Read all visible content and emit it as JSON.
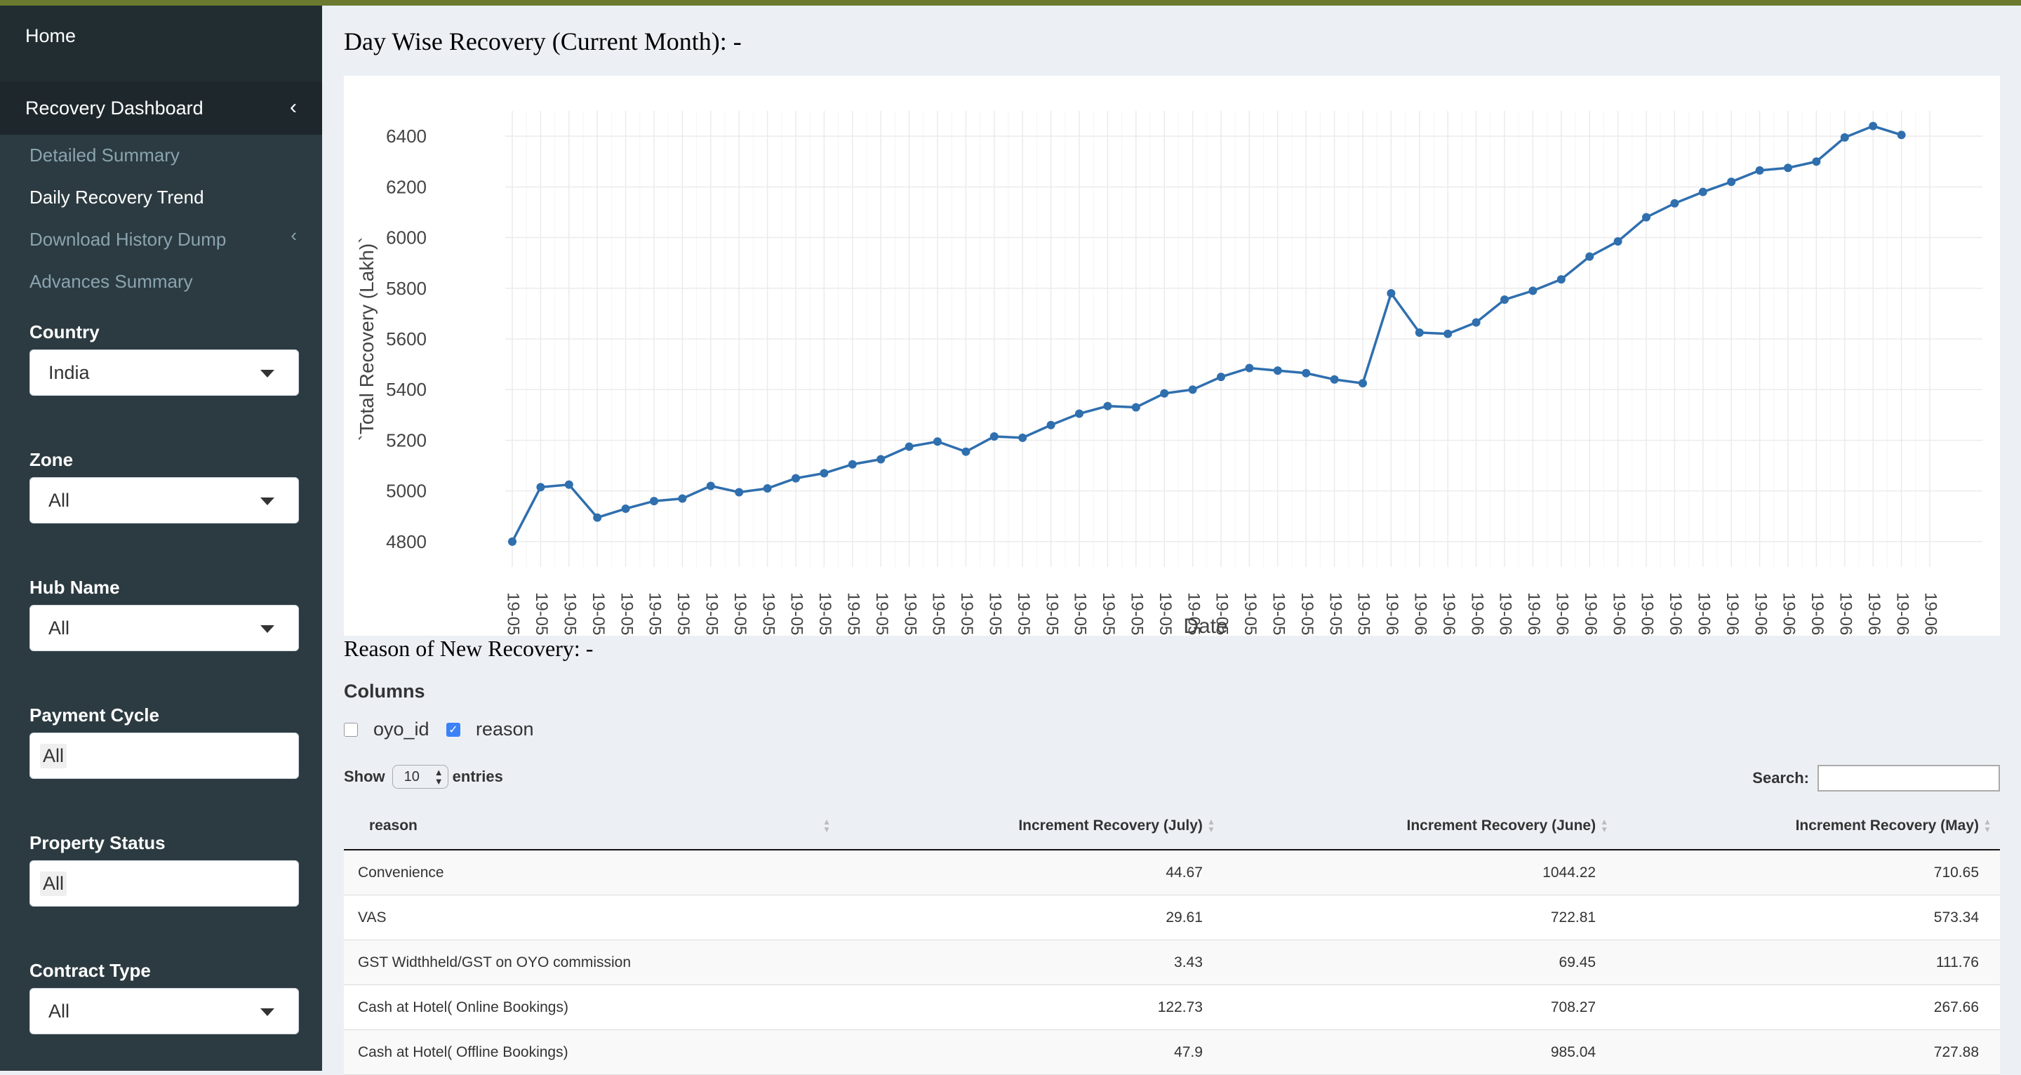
{
  "sidebar": {
    "home": "Home",
    "recovery_dashboard": "Recovery Dashboard",
    "submenu": [
      {
        "label": "Detailed Summary",
        "active": false
      },
      {
        "label": "Daily Recovery Trend",
        "active": true
      },
      {
        "label": "Download History Dump",
        "active": false
      },
      {
        "label": "Advances Summary",
        "active": false
      }
    ],
    "filters": [
      {
        "label": "Country",
        "value": "India",
        "kind": "select"
      },
      {
        "label": "Zone",
        "value": "All",
        "kind": "select"
      },
      {
        "label": "Hub Name",
        "value": "All",
        "kind": "select"
      },
      {
        "label": "Payment Cycle",
        "value": "All",
        "kind": "multi"
      },
      {
        "label": "Property Status",
        "value": "All",
        "kind": "multi"
      },
      {
        "label": "Contract Type",
        "value": "All",
        "kind": "select"
      }
    ]
  },
  "main": {
    "title": "Day Wise Recovery (Current Month): -",
    "section2_title": "Reason of New Recovery: -",
    "columns_label": "Columns",
    "checkbox_oyo": "oyo_id",
    "checkbox_reason": "reason",
    "show_label": "Show",
    "entries_value": "10",
    "entries_label": "entries",
    "search_label": "Search:"
  },
  "table": {
    "headers": [
      "reason",
      "Increment Recovery (July)",
      "Increment Recovery (June)",
      "Increment Recovery (May)"
    ],
    "rows": [
      [
        "Convenience",
        "44.67",
        "1044.22",
        "710.65"
      ],
      [
        "VAS",
        "29.61",
        "722.81",
        "573.34"
      ],
      [
        "GST Widthheld/GST on OYO commission",
        "3.43",
        "69.45",
        "111.76"
      ],
      [
        "Cash at Hotel( Online Bookings)",
        "122.73",
        "708.27",
        "267.66"
      ],
      [
        "Cash at Hotel( Offline Bookings)",
        "47.9",
        "985.04",
        "727.88"
      ]
    ]
  },
  "colors": {
    "line": "#2f6fae",
    "sidebar": "#222d32"
  },
  "chart_data": {
    "type": "line",
    "title": "",
    "xlabel": "Date",
    "ylabel": "`Total Recovery (Lakh)`",
    "ylim": [
      4700,
      6500
    ],
    "yticks": [
      4800,
      5000,
      5200,
      5400,
      5600,
      5800,
      6000,
      6200,
      6400
    ],
    "grid": true,
    "x": [
      "19-05",
      "19-05",
      "19-05",
      "19-05",
      "19-05",
      "19-05",
      "19-05",
      "19-05",
      "19-05",
      "19-05",
      "19-05",
      "19-05",
      "19-05",
      "19-05",
      "19-05",
      "19-05",
      "19-05",
      "19-05",
      "19-05",
      "19-05",
      "19-05",
      "19-05",
      "19-05",
      "19-05",
      "19-05",
      "19-05",
      "19-05",
      "19-05",
      "19-05",
      "19-05",
      "19-05",
      "19-06",
      "19-06",
      "19-06",
      "19-06",
      "19-06",
      "19-06",
      "19-06",
      "19-06",
      "19-06",
      "19-06",
      "19-06",
      "19-06",
      "19-06",
      "19-06",
      "19-06",
      "19-06",
      "19-06",
      "19-06",
      "19-06",
      "19-06"
    ],
    "series": [
      {
        "values": [
          4800,
          5015,
          5025,
          4895,
          4930,
          4960,
          4970,
          5020,
          4995,
          5010,
          5050,
          5070,
          5105,
          5125,
          5175,
          5195,
          5155,
          5215,
          5210,
          5260,
          5305,
          5335,
          5330,
          5385,
          5400,
          5450,
          5485,
          5475,
          5465,
          5440,
          5425,
          5780,
          5625,
          5620,
          5665,
          5755,
          5790,
          5835,
          5925,
          5985,
          6080,
          6135,
          6180,
          6220,
          6265,
          6275,
          6300,
          6395,
          6440,
          6405
        ]
      }
    ]
  }
}
